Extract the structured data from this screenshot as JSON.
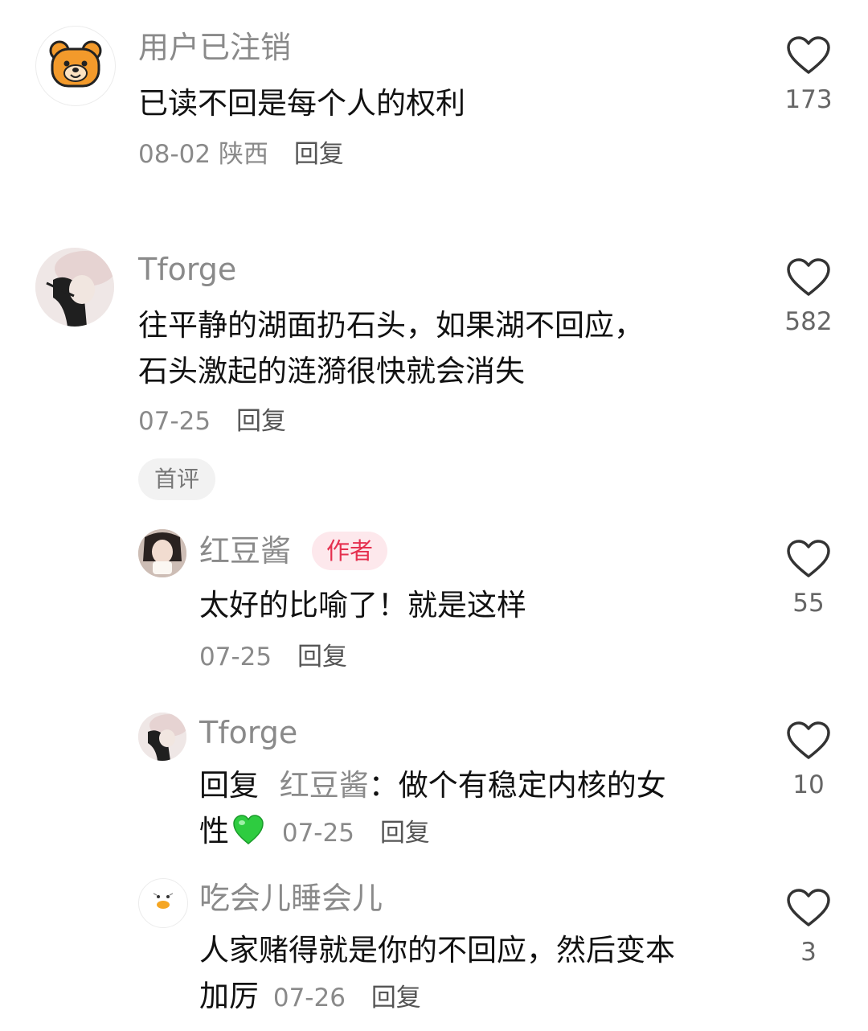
{
  "comments": [
    {
      "user": "用户已注销",
      "text": "已读不回是每个人的权利",
      "date": "08-02",
      "location": "陕西",
      "reply_label": "回复",
      "likes": "173"
    },
    {
      "user": "Tforge",
      "text_line1": "往平静的湖面扔石头，如果湖不回应，",
      "text_line2": "石头激起的涟漪很快就会消失",
      "date": "07-25",
      "reply_label": "回复",
      "likes": "582",
      "tag": "首评"
    }
  ],
  "replies": [
    {
      "user": "红豆酱",
      "badge": "作者",
      "text": "太好的比喻了！就是这样",
      "date": "07-25",
      "reply_label": "回复",
      "likes": "55"
    },
    {
      "user": "Tforge",
      "prefix": "回复",
      "reply_to": "红豆酱",
      "colon": "：",
      "text_line1": "做个有稳定内核的女",
      "text_line2": "性",
      "emoji": "green-heart-emoji",
      "date": "07-25",
      "reply_label": "回复",
      "likes": "10"
    },
    {
      "user": "吃会儿睡会儿",
      "text_line1": "人家赌得就是你的不回应，然后变本",
      "text_line2": "加厉",
      "date": "07-26",
      "reply_label": "回复",
      "likes": "3"
    }
  ],
  "colors": {
    "name_gray": "#8a8a8a",
    "badge_bg": "#fde8ec",
    "badge_text": "#e5304f",
    "pill_bg": "#f2f2f2"
  }
}
